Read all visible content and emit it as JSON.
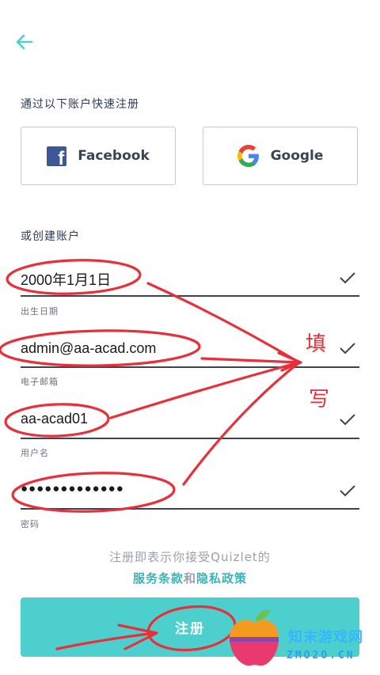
{
  "header": {
    "back_icon": "arrow-left-icon"
  },
  "quick_signup": {
    "label": "通过以下账户快速注册",
    "facebook_label": "Facebook",
    "google_label": "Google"
  },
  "create_account": {
    "label": "或创建账户",
    "fields": [
      {
        "value": "2000年1月1日",
        "caption": "出生日期"
      },
      {
        "value": "admin@aa-acad.com",
        "caption": "电子邮箱"
      },
      {
        "value": "aa-acad01",
        "caption": "用户名"
      },
      {
        "value": "●●●●●●●●●●●●●",
        "caption": "密码"
      }
    ]
  },
  "terms": {
    "text": "注册即表示你接受Quizlet的",
    "service_link": "服务条款",
    "and": "和",
    "privacy_link": "隐私政策"
  },
  "signup_button": {
    "label": "注册"
  },
  "annotations": {
    "note_1": "填",
    "note_2": "写"
  },
  "watermark": {
    "name": "知末游戏网",
    "url": "ZMO2O.CN"
  },
  "colors": {
    "accent": "#4dd0cd",
    "link": "#3bb3b6",
    "annotation": "#e8303a",
    "facebook": "#3b5998"
  }
}
